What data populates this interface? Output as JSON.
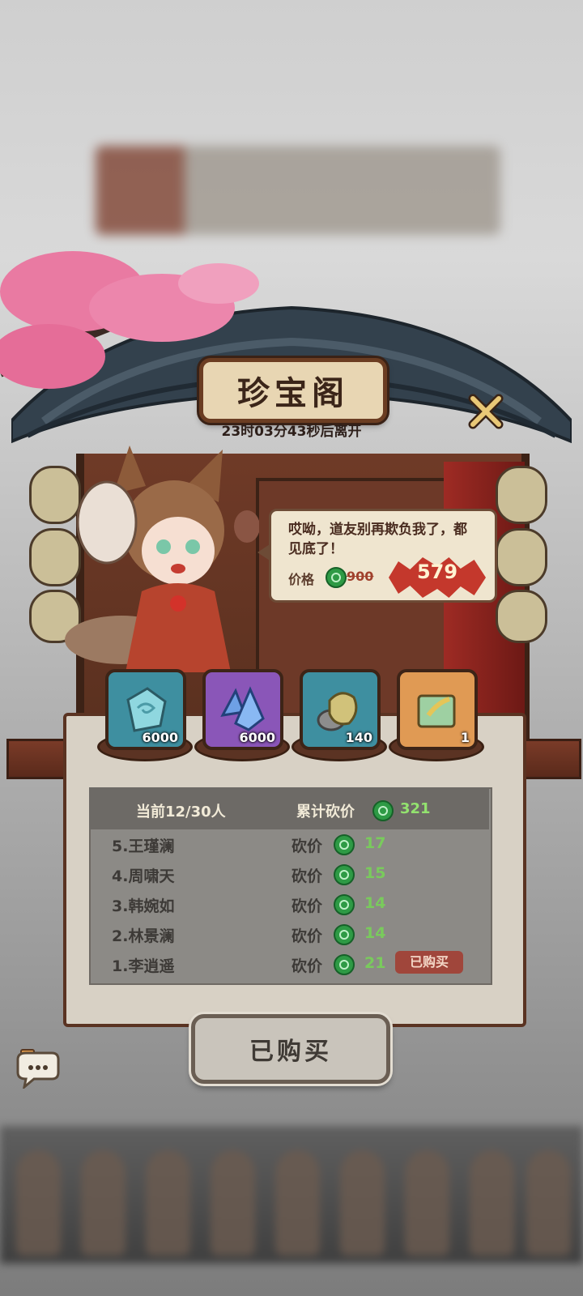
{
  "shop": {
    "title": "珍宝阁",
    "countdown": "23时03分43秒后离开"
  },
  "dialog": {
    "text": "哎呦，道友别再欺负我了，都见底了！",
    "price_label": "价格",
    "original_price": "900",
    "current_price": "579"
  },
  "items": [
    {
      "icon": "jade-stone-icon",
      "qty": "6000"
    },
    {
      "icon": "blue-crystal-icon",
      "qty": "6000"
    },
    {
      "icon": "gold-ore-icon",
      "qty": "140"
    },
    {
      "icon": "golden-scroll-icon",
      "qty": "1"
    }
  ],
  "bargain": {
    "current_people": "当前12/30人",
    "total_label": "累计砍价",
    "total_value": "321",
    "rows": [
      {
        "name": "5.王瑾澜",
        "label": "砍价",
        "amount": "17"
      },
      {
        "name": "4.周啸天",
        "label": "砍价",
        "amount": "15"
      },
      {
        "name": "3.韩婉如",
        "label": "砍价",
        "amount": "14"
      },
      {
        "name": "2.林景澜",
        "label": "砍价",
        "amount": "14"
      },
      {
        "name": "1.李逍遥",
        "label": "砍价",
        "amount": "21",
        "badge": "已购买"
      }
    ]
  },
  "buttons": {
    "bought": "已购买"
  },
  "colors": {
    "accent_green": "#79cb5c",
    "price_red": "#c4382c",
    "wood": "#5a3322"
  }
}
